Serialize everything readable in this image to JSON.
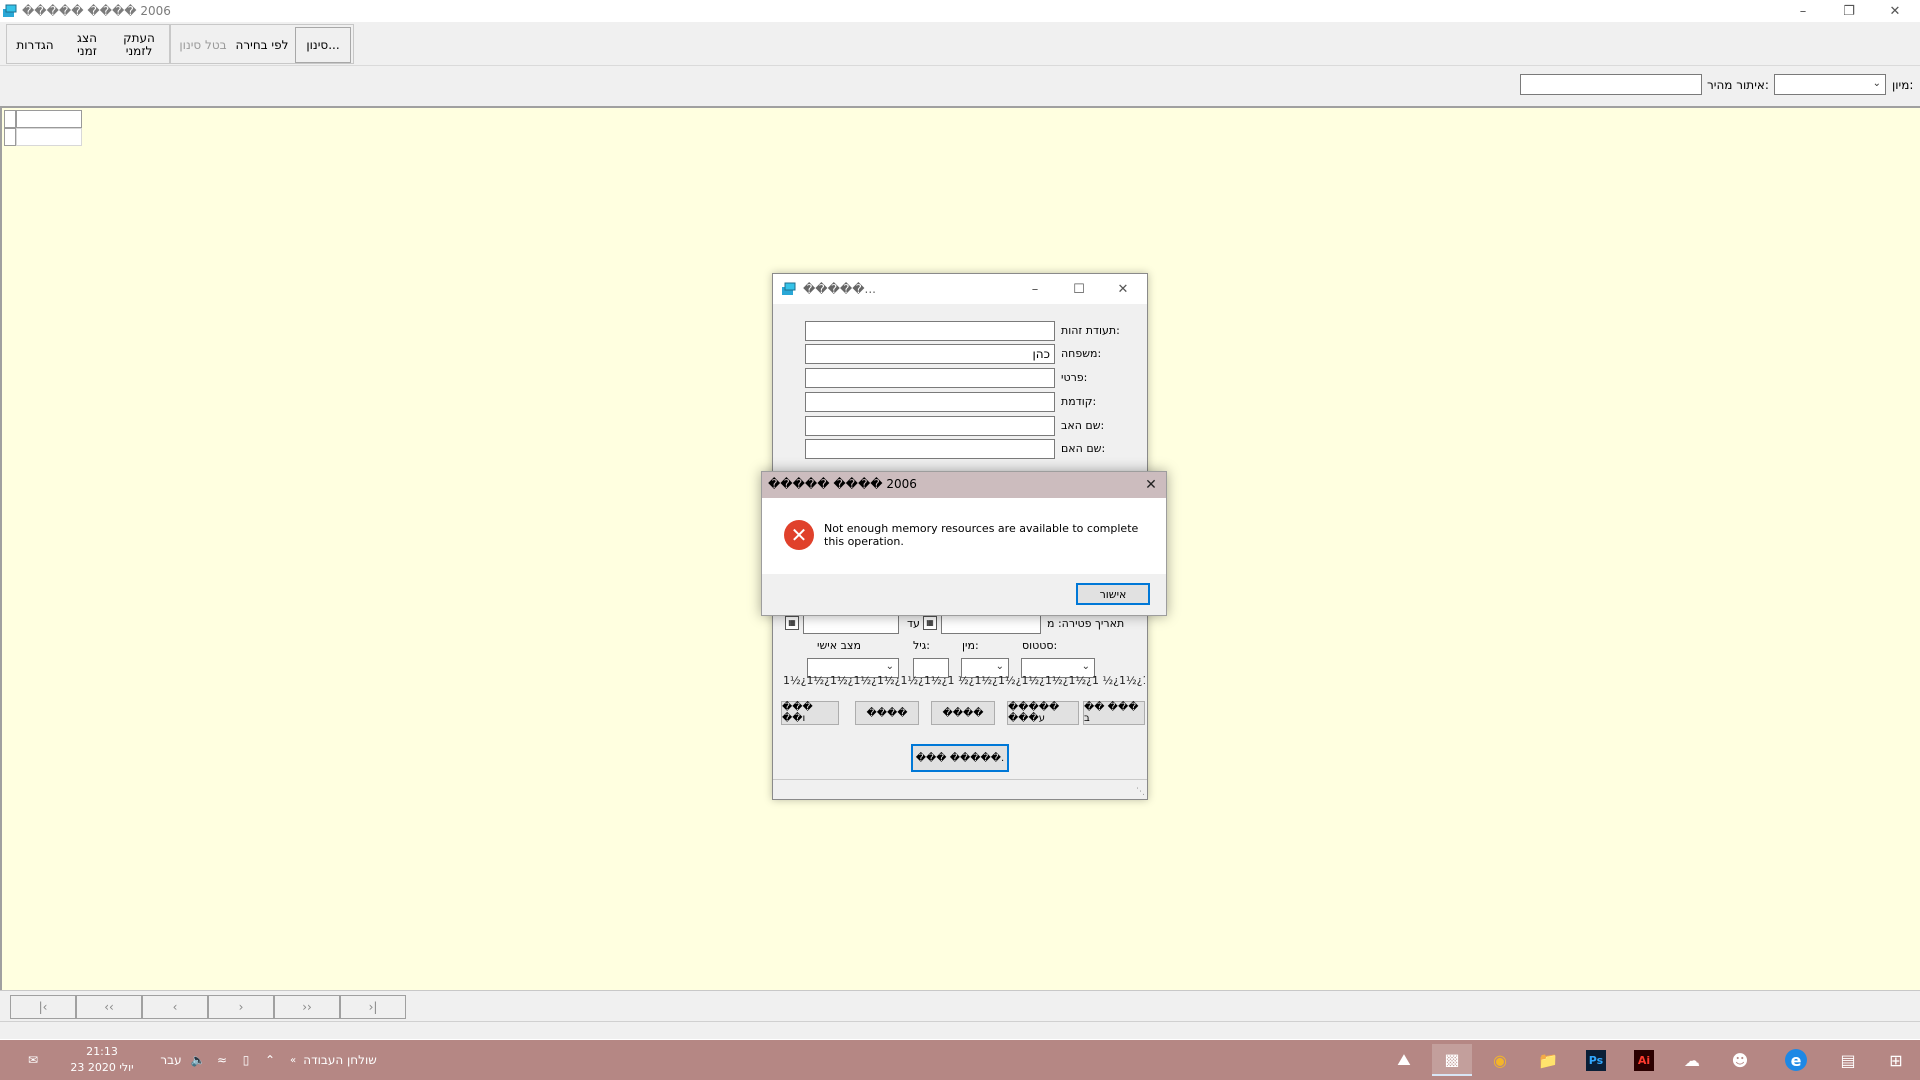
{
  "window": {
    "title": "����� ���� 2006"
  },
  "toolbar": {
    "settings": "הגדרות",
    "show_temp": "הצג זמני",
    "copy_temp": "העתק לזמני",
    "cancel_filter": "בטל סינון",
    "by_selection": "לפי בחירה",
    "filter": "סינון..."
  },
  "filterbar": {
    "sort_label": "מיון:",
    "quick_find_label": "איתור מהיר:",
    "sort_value": "",
    "quick_find_value": ""
  },
  "form": {
    "title": "�����...",
    "fields": [
      {
        "label": "תעודת זהות:",
        "value": ""
      },
      {
        "label": "משפחה:",
        "value": "כהן"
      },
      {
        "label": "פרטי:",
        "value": ""
      },
      {
        "label": "קודמת:",
        "value": ""
      },
      {
        "label": "שם האב:",
        "value": ""
      },
      {
        "label": "שם האם:",
        "value": ""
      }
    ],
    "death_date_label": "תאריך פטירה: מ",
    "to_label": "עד",
    "status_label": "סטטוס:",
    "gender_label": "מין:",
    "age_label": "גיל:",
    "marital_label": "מצב אישי",
    "garbled_line": "1½¿1½¿1½¿1½¿1½¿1½¿1½¿1 ½¿1½¿1½¿1½¿1½¿1½¿1 ½¿1½¿1½¿1½¿1½¿1½¿1½¿1½¿1½¿1",
    "buttons": [
      "�� ��� ב",
      "����� ���ע",
      "����",
      "����",
      "��� ��ו"
    ],
    "ok_button": "��� �����."
  },
  "msgbox": {
    "title": "����� ���� 2006",
    "message": "Not enough memory resources are available to complete this operation.",
    "ok": "אישור"
  },
  "taskbar": {
    "time": "21:13",
    "date": "23 יולי 2020",
    "language": "עבר",
    "desktop": "שולחן העבודה"
  },
  "colors": {
    "workarea": "#ffffe0",
    "taskbar": "#b58784",
    "msgbox_title": "#ccbcbe",
    "accent": "#0078d7",
    "error": "#e0412b"
  }
}
